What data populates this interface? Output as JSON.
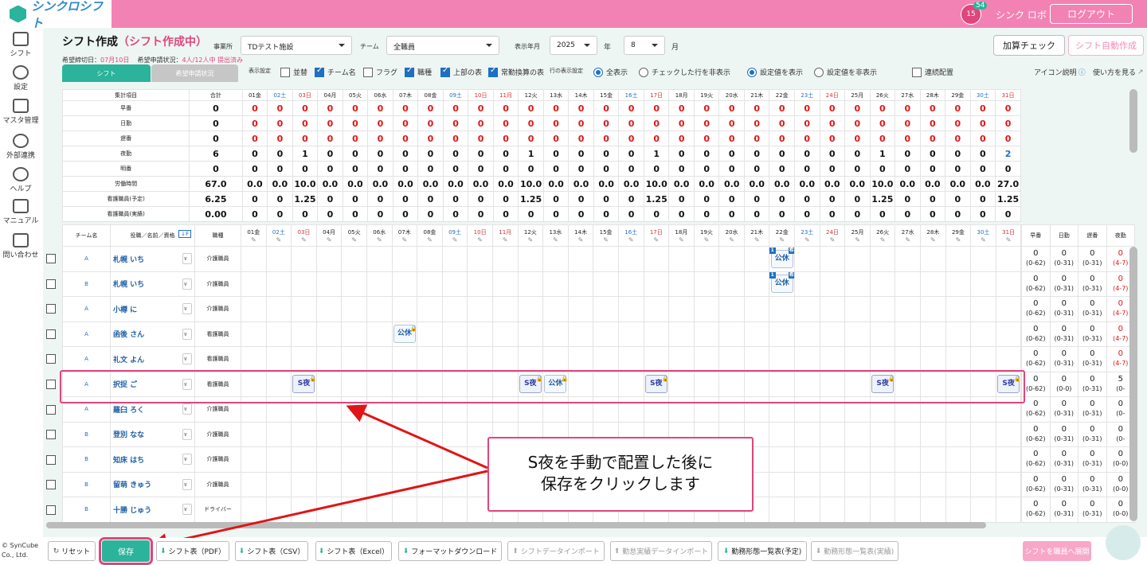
{
  "header": {
    "logo": "シンクロシフト",
    "badge_day": "15",
    "badge_count": "54",
    "user": "シンク ロボ",
    "logout": "ログアウト"
  },
  "sidebar": [
    {
      "label": "シフト"
    },
    {
      "label": "設定"
    },
    {
      "label": "マスタ管理"
    },
    {
      "label": "外部連携"
    },
    {
      "label": "ヘルプ"
    },
    {
      "label": "マニュアル"
    },
    {
      "label": "問い合わせ"
    }
  ],
  "copyright": "© SynCube Co., Ltd.",
  "page": {
    "title": "シフト作成",
    "status": "（シフト作成中）",
    "deadline_label": "希望締切日：",
    "deadline": "07月10日",
    "request_label": "希望申請状況：",
    "request": "4人/12人中 提出済み"
  },
  "filters": {
    "office_label": "事業所",
    "office": "TDテスト施設",
    "team_label": "チーム",
    "team": "全職員",
    "year_label": "表示年月",
    "year": "2025",
    "year_unit": "年",
    "month": "8",
    "month_unit": "月"
  },
  "buttons": {
    "calc_check": "加算チェック",
    "auto_create": "シフト自動作成"
  },
  "tabs": {
    "shift": "シフト",
    "request": "希望申請状況"
  },
  "options": {
    "display_label": "表示設定",
    "sort": "並替",
    "team_name": "チーム名",
    "flag": "フラグ",
    "job": "職種",
    "top_table": "上部の表",
    "fte": "常勤換算の表",
    "row_label": "行の表示設定",
    "show_all": "全表示",
    "hide_checked": "チェックした行を非表示",
    "show_setting": "設定値を表示",
    "hide_setting": "設定値を非表示",
    "consecutive": "連続配置",
    "icon_help": "アイコン説明",
    "how_to": "使い方を見る"
  },
  "days": [
    {
      "d": "01金",
      "t": ""
    },
    {
      "d": "02土",
      "t": "sat"
    },
    {
      "d": "03日",
      "t": "sun"
    },
    {
      "d": "04月",
      "t": ""
    },
    {
      "d": "05火",
      "t": ""
    },
    {
      "d": "06水",
      "t": ""
    },
    {
      "d": "07木",
      "t": ""
    },
    {
      "d": "08金",
      "t": ""
    },
    {
      "d": "09土",
      "t": "sat"
    },
    {
      "d": "10日",
      "t": "sun"
    },
    {
      "d": "11月",
      "t": "sun"
    },
    {
      "d": "12火",
      "t": ""
    },
    {
      "d": "13水",
      "t": ""
    },
    {
      "d": "14木",
      "t": ""
    },
    {
      "d": "15金",
      "t": ""
    },
    {
      "d": "16土",
      "t": "sat"
    },
    {
      "d": "17日",
      "t": "sun"
    },
    {
      "d": "18月",
      "t": ""
    },
    {
      "d": "19火",
      "t": ""
    },
    {
      "d": "20水",
      "t": ""
    },
    {
      "d": "21木",
      "t": ""
    },
    {
      "d": "22金",
      "t": ""
    },
    {
      "d": "23土",
      "t": "sat"
    },
    {
      "d": "24日",
      "t": "sun"
    },
    {
      "d": "25月",
      "t": ""
    },
    {
      "d": "26火",
      "t": ""
    },
    {
      "d": "27水",
      "t": ""
    },
    {
      "d": "28木",
      "t": ""
    },
    {
      "d": "29金",
      "t": ""
    },
    {
      "d": "30土",
      "t": "sat"
    },
    {
      "d": "31日",
      "t": "sun"
    }
  ],
  "summary": {
    "header_item": "集計項目",
    "header_total": "合計",
    "rows": [
      {
        "label": "早番",
        "total": "0",
        "cls": "red",
        "vals": [
          "0",
          "0",
          "0",
          "0",
          "0",
          "0",
          "0",
          "0",
          "0",
          "0",
          "0",
          "0",
          "0",
          "0",
          "0",
          "0",
          "0",
          "0",
          "0",
          "0",
          "0",
          "0",
          "0",
          "0",
          "0",
          "0",
          "0",
          "0",
          "0",
          "0",
          "0"
        ]
      },
      {
        "label": "日勤",
        "total": "0",
        "cls": "red",
        "vals": [
          "0",
          "0",
          "0",
          "0",
          "0",
          "0",
          "0",
          "0",
          "0",
          "0",
          "0",
          "0",
          "0",
          "0",
          "0",
          "0",
          "0",
          "0",
          "0",
          "0",
          "0",
          "0",
          "0",
          "0",
          "0",
          "0",
          "0",
          "0",
          "0",
          "0",
          "0"
        ]
      },
      {
        "label": "遅番",
        "total": "0",
        "cls": "red",
        "vals": [
          "0",
          "0",
          "0",
          "0",
          "0",
          "0",
          "0",
          "0",
          "0",
          "0",
          "0",
          "0",
          "0",
          "0",
          "0",
          "0",
          "0",
          "0",
          "0",
          "0",
          "0",
          "0",
          "0",
          "0",
          "0",
          "0",
          "0",
          "0",
          "0",
          "0",
          "0"
        ]
      },
      {
        "label": "夜勤",
        "total": "6",
        "cls": "blk",
        "vals": [
          "0",
          "0",
          "1",
          "0",
          "0",
          "0",
          "0",
          "0",
          "0",
          "0",
          "0",
          "1",
          "0",
          "0",
          "0",
          "0",
          "1",
          "0",
          "0",
          "0",
          "0",
          "0",
          "0",
          "0",
          "0",
          "1",
          "0",
          "0",
          "0",
          "0",
          "2"
        ]
      },
      {
        "label": "明番",
        "total": "0",
        "cls": "blk",
        "vals": [
          "0",
          "0",
          "0",
          "0",
          "0",
          "0",
          "0",
          "0",
          "0",
          "0",
          "0",
          "0",
          "0",
          "0",
          "0",
          "0",
          "0",
          "0",
          "0",
          "0",
          "0",
          "0",
          "0",
          "0",
          "0",
          "0",
          "0",
          "0",
          "0",
          "0",
          "0"
        ]
      },
      {
        "label": "労働時間",
        "total": "67.0",
        "cls": "blk",
        "vals": [
          "0.0",
          "0.0",
          "10.0",
          "0.0",
          "0.0",
          "0.0",
          "0.0",
          "0.0",
          "0.0",
          "0.0",
          "0.0",
          "10.0",
          "0.0",
          "0.0",
          "0.0",
          "0.0",
          "10.0",
          "0.0",
          "0.0",
          "0.0",
          "0.0",
          "0.0",
          "0.0",
          "0.0",
          "0.0",
          "10.0",
          "0.0",
          "0.0",
          "0.0",
          "0.0",
          "27.0"
        ]
      },
      {
        "label": "看護職員(予定)",
        "total": "6.25",
        "cls": "blk",
        "vals": [
          "0",
          "0",
          "1.25",
          "0",
          "0",
          "0",
          "0",
          "0",
          "0",
          "0",
          "0",
          "1.25",
          "0",
          "0",
          "0",
          "0",
          "1.25",
          "0",
          "0",
          "0",
          "0",
          "0",
          "0",
          "0",
          "0",
          "1.25",
          "0",
          "0",
          "0",
          "0",
          "1.25"
        ]
      },
      {
        "label": "看護職員(実績)",
        "total": "0.00",
        "cls": "blk",
        "vals": [
          "0",
          "0",
          "0",
          "0",
          "0",
          "0",
          "0",
          "0",
          "0",
          "0",
          "0",
          "0",
          "0",
          "0",
          "0",
          "0",
          "0",
          "0",
          "0",
          "0",
          "0",
          "0",
          "0",
          "0",
          "0",
          "0",
          "0",
          "0",
          "0",
          "0",
          "0"
        ]
      }
    ]
  },
  "staff_header": {
    "team": "チーム名",
    "name": "役職／名前／資格",
    "job": "職種"
  },
  "staff": [
    {
      "team": "A",
      "name": "札幌 いち",
      "job": "介護職員",
      "shifts": {
        "22": "公休"
      }
    },
    {
      "team": "B",
      "name": "札幌 いち",
      "job": "介護職員",
      "shifts": {
        "22": "公休"
      }
    },
    {
      "team": "A",
      "name": "小樽 に",
      "job": "介護職員",
      "shifts": {}
    },
    {
      "team": "A",
      "name": "函後 さん",
      "job": "看護職員",
      "shifts": {
        "7": "公休"
      }
    },
    {
      "team": "A",
      "name": "礼文 よん",
      "job": "看護職員",
      "shifts": {}
    },
    {
      "team": "A",
      "name": "択捉 ご",
      "job": "看護職員",
      "shifts": {
        "3": "S夜",
        "12": "S夜",
        "13": "公休",
        "17": "S夜",
        "26": "S夜",
        "31": "S夜"
      }
    },
    {
      "team": "A",
      "name": "羅臼 ろく",
      "job": "介護職員",
      "shifts": {}
    },
    {
      "team": "B",
      "name": "登別 なな",
      "job": "介護職員",
      "shifts": {}
    },
    {
      "team": "B",
      "name": "知床 はち",
      "job": "介護職員",
      "shifts": {}
    },
    {
      "team": "B",
      "name": "留萌 きゅう",
      "job": "介護職員",
      "shifts": {}
    },
    {
      "team": "B",
      "name": "十勝 じゅう",
      "job": "ドライバー",
      "shifts": {}
    }
  ],
  "totals_header": [
    "早番",
    "日勤",
    "遅番",
    "夜勤"
  ],
  "totals": [
    [
      [
        "0",
        "(0-62)"
      ],
      [
        "0",
        "(0-31)"
      ],
      [
        "0",
        "(0-31)"
      ],
      [
        "0",
        "(4-7)"
      ]
    ],
    [
      [
        "0",
        "(0-62)"
      ],
      [
        "0",
        "(0-31)"
      ],
      [
        "0",
        "(0-31)"
      ],
      [
        "0",
        "(4-7)"
      ]
    ],
    [
      [
        "0",
        "(0-62)"
      ],
      [
        "0",
        "(0-31)"
      ],
      [
        "0",
        "(0-31)"
      ],
      [
        "0",
        "(4-7)"
      ]
    ],
    [
      [
        "0",
        "(0-62)"
      ],
      [
        "0",
        "(0-31)"
      ],
      [
        "0",
        "(0-31)"
      ],
      [
        "0",
        "(4-7)"
      ]
    ],
    [
      [
        "0",
        "(0-62)"
      ],
      [
        "0",
        "(0-31)"
      ],
      [
        "0",
        "(0-31)"
      ],
      [
        "0",
        "(4-7)"
      ]
    ],
    [
      [
        "0",
        "(0-62)"
      ],
      [
        "0",
        "(0-0)"
      ],
      [
        "0",
        "(0-31)"
      ],
      [
        "5",
        "(0-"
      ]
    ],
    [
      [
        "0",
        "(0-62)"
      ],
      [
        "0",
        "(0-31)"
      ],
      [
        "0",
        "(0-31)"
      ],
      [
        "0",
        "(0-"
      ]
    ],
    [
      [
        "0",
        "(0-62)"
      ],
      [
        "0",
        "(0-31)"
      ],
      [
        "0",
        "(0-31)"
      ],
      [
        "0",
        "(0-"
      ]
    ],
    [
      [
        "0",
        "(0-62)"
      ],
      [
        "0",
        "(0-31)"
      ],
      [
        "0",
        "(0-31)"
      ],
      [
        "0",
        "(0-0)"
      ]
    ],
    [
      [
        "0",
        "(0-62)"
      ],
      [
        "0",
        "(0-31)"
      ],
      [
        "0",
        "(0-31)"
      ],
      [
        "0",
        "(0-0)"
      ]
    ],
    [
      [
        "0",
        "(0-62)"
      ],
      [
        "0",
        "(0-31)"
      ],
      [
        "0",
        "(0-31)"
      ],
      [
        "0",
        "(0-0)"
      ]
    ]
  ],
  "callout": {
    "line1": "S夜を手動で配置した後に",
    "line2": "保存をクリックします"
  },
  "bottom": {
    "reset": "リセット",
    "save": "保存",
    "pdf": "シフト表（PDF）",
    "csv": "シフト表（CSV）",
    "excel": "シフト表（Excel）",
    "format": "フォーマットダウンロード",
    "import": "シフトデータインポート",
    "attendance": "勤怠実績データインポート",
    "plan": "勤務形態一覧表(予定)",
    "actual": "勤務形態一覧表(実績)",
    "deploy": "シフトを職員へ展開"
  }
}
